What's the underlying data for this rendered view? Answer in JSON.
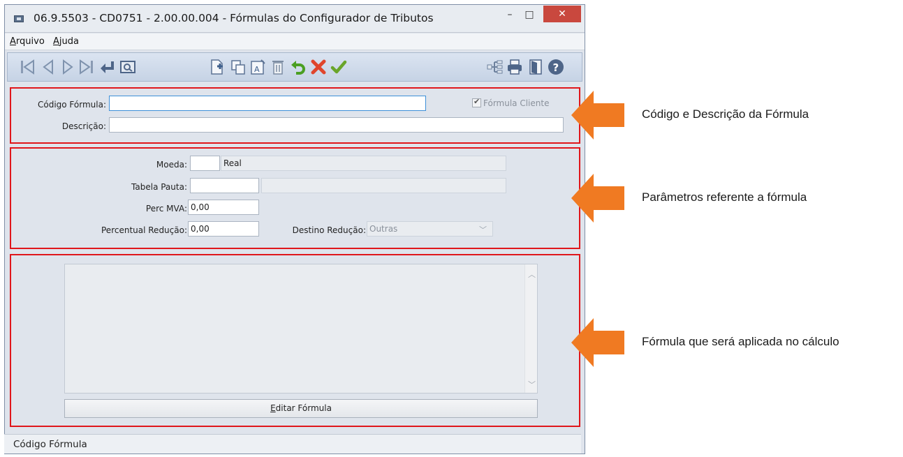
{
  "window": {
    "title": "06.9.5503 - CD0751 - 2.00.00.004 - Fórmulas do Configurador de Tributos",
    "minimize": "–",
    "maximize": "□",
    "close": "✕"
  },
  "menu": {
    "file_prefix": "A",
    "file_rest": "rquivo",
    "help_prefix": "A",
    "help_rest": "juda"
  },
  "toolbar_icons": [
    "first-record-icon",
    "previous-record-icon",
    "next-record-icon",
    "last-record-icon",
    "go-to-icon",
    "search-icon",
    "new-record-icon",
    "copy-record-icon",
    "edit-text-icon",
    "delete-icon",
    "undo-icon",
    "cancel-icon",
    "save-check-icon",
    "tree-structure-icon",
    "print-icon",
    "exit-door-icon",
    "help-icon"
  ],
  "colors": {
    "highlight_box": "#e0161b",
    "arrow": "#f07a22"
  },
  "section1": {
    "codigo_label": "Código Fórmula:",
    "codigo_value": "",
    "descricao_label": "Descrição:",
    "descricao_value": "",
    "cliente_label": "Fórmula Cliente",
    "cliente_checked": true
  },
  "section2": {
    "moeda_label": "Moeda:",
    "moeda_code": "",
    "moeda_name": "Real",
    "tabela_label": "Tabela Pauta:",
    "tabela_code": "",
    "tabela_desc": "",
    "perc_mva_label": "Perc MVA:",
    "perc_mva_value": "0,00",
    "perc_red_label": "Percentual Redução:",
    "perc_red_value": "0,00",
    "destino_label": "Destino Redução:",
    "destino_value": "Outras"
  },
  "section3": {
    "formula_text": "",
    "edit_prefix": "E",
    "edit_rest": "ditar Fórmula"
  },
  "status": {
    "text": "Código Fórmula"
  },
  "annotations": {
    "a1": "Código e Descrição da Fórmula",
    "a2": "Parâmetros referente a fórmula",
    "a3": "Fórmula que será aplicada no cálculo"
  }
}
